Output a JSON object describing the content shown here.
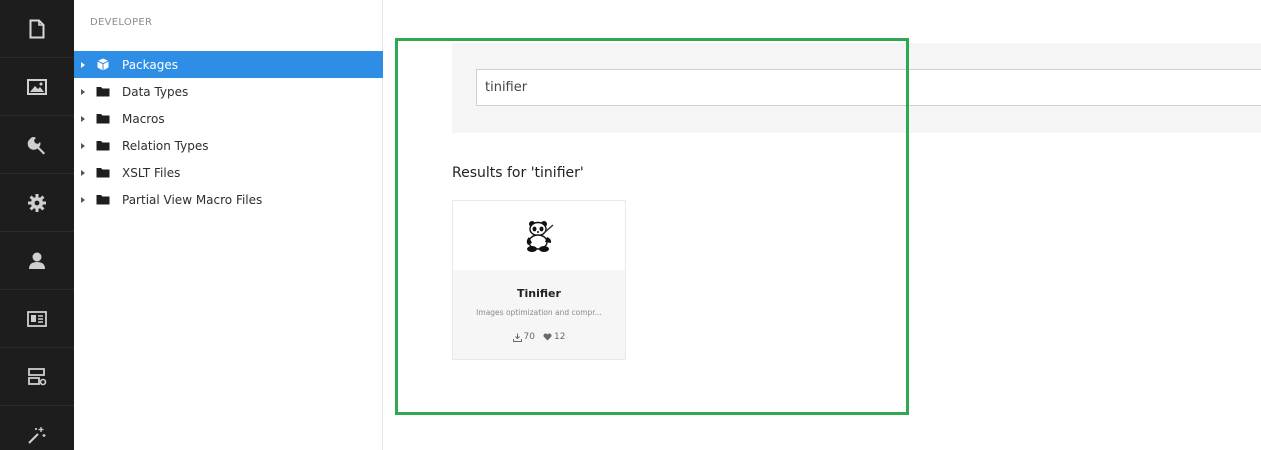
{
  "rail": {
    "items": [
      {
        "icon": "content-icon"
      },
      {
        "icon": "media-icon"
      },
      {
        "icon": "wrench-icon"
      },
      {
        "icon": "gear-icon"
      },
      {
        "icon": "user-icon"
      },
      {
        "icon": "member-card-icon"
      },
      {
        "icon": "forms-icon"
      },
      {
        "icon": "magic-wand-icon"
      }
    ]
  },
  "tree": {
    "section_title": "DEVELOPER",
    "items": [
      {
        "label": "Packages",
        "icon": "package-icon",
        "active": true
      },
      {
        "label": "Data Types",
        "icon": "folder-icon"
      },
      {
        "label": "Macros",
        "icon": "folder-icon"
      },
      {
        "label": "Relation Types",
        "icon": "folder-icon"
      },
      {
        "label": "XSLT Files",
        "icon": "folder-icon"
      },
      {
        "label": "Partial View Macro Files",
        "icon": "folder-icon"
      }
    ]
  },
  "search": {
    "value": "tinifier"
  },
  "results": {
    "title": "Results for 'tinifier'",
    "cards": [
      {
        "name": "Tinifier",
        "description": "Images optimization and compr...",
        "downloads": "70",
        "likes": "12",
        "image": "panda-logo"
      }
    ]
  },
  "colors": {
    "rail_bg": "#1d1d1d",
    "active_item": "#2e8ee6",
    "highlight": "#2fa84f"
  }
}
